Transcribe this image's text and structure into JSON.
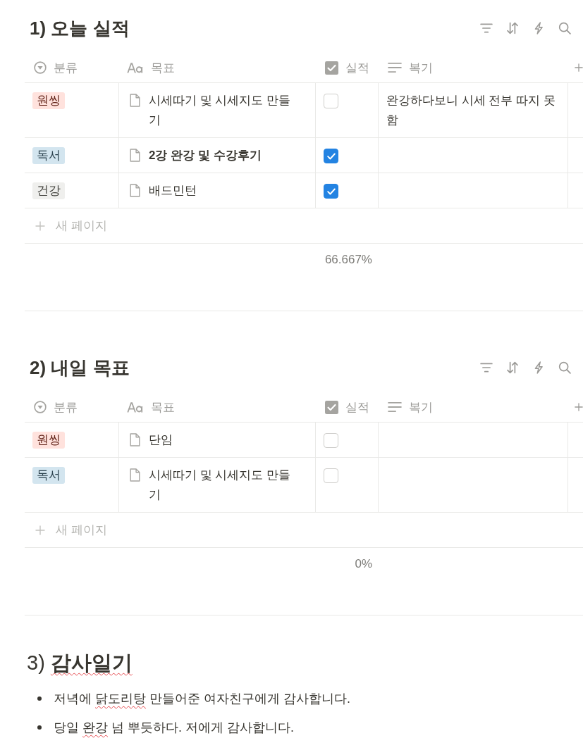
{
  "sections": [
    {
      "kind": "table",
      "title": "1) 오늘 실적",
      "columns": [
        {
          "kind": "select",
          "label": "분류"
        },
        {
          "kind": "title",
          "label": "목표"
        },
        {
          "kind": "checkbox",
          "label": "실적"
        },
        {
          "kind": "text",
          "label": "복기"
        }
      ],
      "rows": [
        {
          "category": {
            "label": "원씽",
            "color": "#ffe2dd"
          },
          "title": "시세따기 및 시세지도 만들기",
          "title_bold": false,
          "done": false,
          "review": "완강하다보니 시세 전부 따지 못함"
        },
        {
          "category": {
            "label": "독서",
            "color": "#d3e5ef"
          },
          "title": "2강 완강 및 수강후기",
          "title_bold": true,
          "done": true
        },
        {
          "category": {
            "label": "건강",
            "color": "#efefed"
          },
          "title": "배드민턴",
          "title_bold": false,
          "done": true
        }
      ],
      "new_row_label": "새 페이지",
      "summary": "66.667%"
    },
    {
      "kind": "table",
      "title": "2) 내일 목표",
      "columns": [
        {
          "kind": "select",
          "label": "분류"
        },
        {
          "kind": "title",
          "label": "목표"
        },
        {
          "kind": "checkbox",
          "label": "실적"
        },
        {
          "kind": "text",
          "label": "복기"
        }
      ],
      "rows": [
        {
          "category": {
            "label": "원씽",
            "color": "#ffe2dd"
          },
          "title": "단임",
          "title_bold": false,
          "done": false
        },
        {
          "category": {
            "label": "독서",
            "color": "#d3e5ef"
          },
          "title": "시세따기 및 시세지도 만들기",
          "title_bold": false,
          "done": false
        }
      ],
      "new_row_label": "새 페이지",
      "summary": "0%"
    },
    {
      "kind": "text",
      "heading": [
        {
          "text": "3) ",
          "bold": false,
          "misspelled": false
        },
        {
          "text": "감사일기",
          "bold": true,
          "misspelled": true
        }
      ],
      "bullets": [
        {
          "segments": [
            {
              "text": "저녁에 ",
              "misspelled": false
            },
            {
              "text": "닭도리탕",
              "misspelled": true
            },
            {
              "text": " 만들어준 여자친구에게 감사합니다.",
              "misspelled": false
            }
          ]
        },
        {
          "segments": [
            {
              "text": "당일 ",
              "misspelled": false
            },
            {
              "text": "완강",
              "misspelled": true
            },
            {
              "text": " 넘 뿌듯하다. 저에게 감사합니다.",
              "misspelled": false
            }
          ]
        }
      ]
    }
  ]
}
